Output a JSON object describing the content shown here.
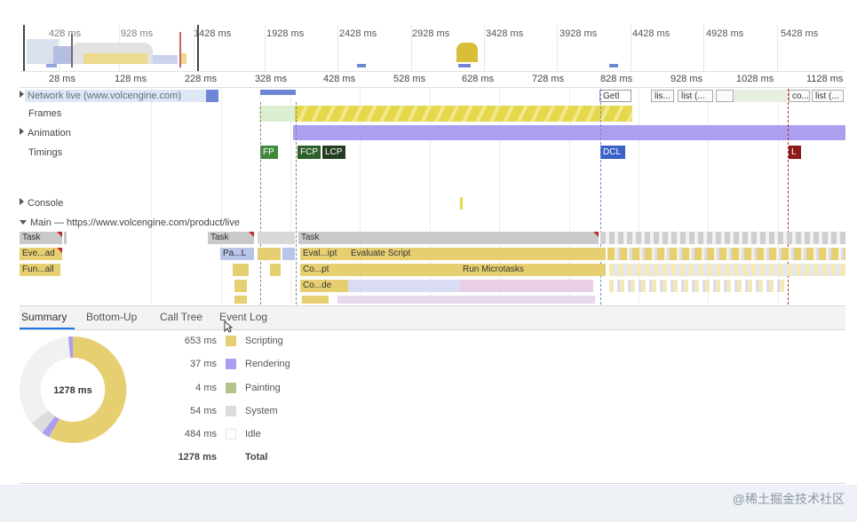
{
  "overview": {
    "ticks": [
      "428 ms",
      "928 ms",
      "1428 ms",
      "1928 ms",
      "2428 ms",
      "2928 ms",
      "3428 ms",
      "3928 ms",
      "4428 ms",
      "4928 ms",
      "5428 ms"
    ]
  },
  "ruler": {
    "ticks": [
      "28 ms",
      "128 ms",
      "228 ms",
      "328 ms",
      "428 ms",
      "528 ms",
      "628 ms",
      "728 ms",
      "828 ms",
      "928 ms",
      "1028 ms",
      "1128 ms"
    ]
  },
  "tracks": {
    "network_label": "Network live (www.volcengine.com)",
    "network_items": [
      "Getl",
      "lis...",
      "list (...",
      "co...",
      "list (..."
    ],
    "frames_label": "Frames",
    "animation_label": "Animation",
    "timings_label": "Timings",
    "console_label": "Console",
    "main_label": "Main — https://www.volcengine.com/product/live"
  },
  "timings": {
    "fp": "FP",
    "fcp": "FCP",
    "lcp": "LCP",
    "dcl": "DCL",
    "l": "L"
  },
  "flame": {
    "task1": "Task",
    "task2": "Task",
    "task3": "Task",
    "eval1": "Eve...ad",
    "fun1": "Fun...all",
    "pa": "Pa...L",
    "eval2": "Eval...ipt",
    "evaluate_script": "Evaluate Script",
    "copt": "Co...pt",
    "run_micro": "Run Microtasks",
    "code": "Co...de"
  },
  "tabs": {
    "summary": "Summary",
    "bottom_up": "Bottom-Up",
    "call_tree": "Call Tree",
    "event_log": "Event Log"
  },
  "summary": {
    "total_center": "1278 ms",
    "rows": [
      {
        "value": "653 ms",
        "label": "Scripting",
        "color": "#e6cf70"
      },
      {
        "value": "37 ms",
        "label": "Rendering",
        "color": "#a99ef0"
      },
      {
        "value": "4 ms",
        "label": "Painting",
        "color": "#b4c48a"
      },
      {
        "value": "54 ms",
        "label": "System",
        "color": "#dcdcdc"
      },
      {
        "value": "484 ms",
        "label": "Idle",
        "color": "#ffffff"
      }
    ],
    "total_value": "1278 ms",
    "total_label": "Total"
  },
  "watermark": "@稀土掘金技术社区"
}
